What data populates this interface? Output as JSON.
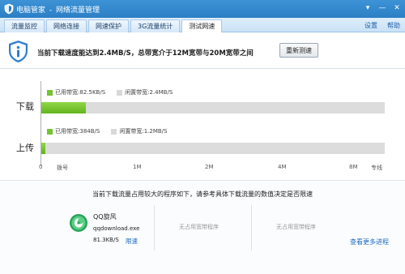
{
  "window": {
    "title_app": "电脑管家",
    "title_sep": "-",
    "title_module": "网络流量管理",
    "controls": {
      "menu": "▾",
      "minimize": "—",
      "close": "✕"
    }
  },
  "tabs": [
    {
      "label": "流量监控"
    },
    {
      "label": "网络连接"
    },
    {
      "label": "网速保护"
    },
    {
      "label": "3G流量统计"
    },
    {
      "label": "测试网速",
      "active": true
    }
  ],
  "tabbar_right": {
    "settings": "设置",
    "help": "帮助"
  },
  "banner": {
    "message": "当前下载速度能达到2.4MB/S，总带宽介于12M宽带与20M宽带之间",
    "retest_button": "重新测速"
  },
  "chart_data": {
    "type": "bar",
    "categories": [
      "下载",
      "上传"
    ],
    "series": [
      {
        "name": "已用带宽",
        "values": [
          "82.5KB/S",
          "384B/S"
        ]
      },
      {
        "name": "闲置带宽",
        "values": [
          "2.4MB/S",
          "1.2MB/S"
        ]
      }
    ],
    "download": {
      "label": "下载",
      "used_label": "已用带宽:",
      "used_value": "82.5KB/S",
      "idle_label": "闲置带宽:",
      "idle_value": "2.4MB/S",
      "used_fraction": 0.13
    },
    "upload": {
      "label": "上传",
      "used_label": "已用带宽:",
      "used_value": "384B/S",
      "idle_label": "闲置带宽:",
      "idle_value": "1.2MB/S",
      "used_fraction": 0.012
    },
    "x_ticks": [
      "0",
      "拨号",
      "1M",
      "2M",
      "4M",
      "8M",
      "专线"
    ],
    "colors": {
      "used": "#73c42f",
      "idle": "#d8d8d8"
    }
  },
  "bottom": {
    "hint": "当前下载流量占用较大的程序如下，请参考具体下载流量的数值决定是否限速",
    "program": {
      "name": "QQ旋风",
      "exe": "qqdownload.exe",
      "speed": "81.3KB/S",
      "limit_link": "限速",
      "icon": "qqxuanfeng-icon"
    },
    "empty_slot_1": "无占用宽带程序",
    "empty_slot_2": "无占用宽带程序",
    "more_link": "查看更多进程"
  }
}
